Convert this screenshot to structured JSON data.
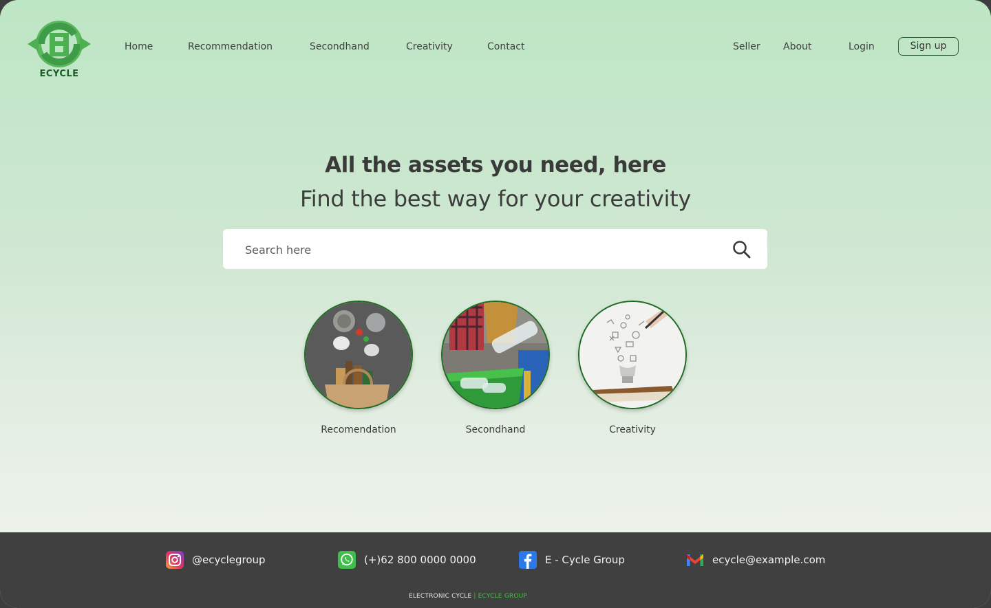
{
  "brand": {
    "name": "ECYCLE",
    "primary_color": "#4caf50",
    "dark_color": "#1f5e2a"
  },
  "nav": {
    "home": "Home",
    "recommendation": "Recommendation",
    "secondhand": "Secondhand",
    "creativity": "Creativity",
    "contact": "Contact",
    "seller": "Seller",
    "about": "About",
    "login": "Login",
    "signup": "Sign up"
  },
  "hero": {
    "headline": "All the assets you need, here",
    "subline": "Find the best way for your creativity"
  },
  "search": {
    "placeholder": "Search here",
    "value": "",
    "icon": "search-icon"
  },
  "categories": [
    {
      "label": "Recomendation",
      "icon": "recyclables-bag-image"
    },
    {
      "label": "Secondhand",
      "icon": "plastic-bottles-bin-image"
    },
    {
      "label": "Creativity",
      "icon": "lightbulb-sketch-image"
    }
  ],
  "footer": {
    "instagram": "@ecyclegroup",
    "whatsapp": "(+)62 800 0000 0000",
    "facebook": "E - Cycle Group",
    "email": "ecycle@example.com",
    "copyright_left": "ELECTRONIC CYCLE",
    "copyright_sep": "|",
    "copyright_right": "ECYCLE GROUP"
  }
}
